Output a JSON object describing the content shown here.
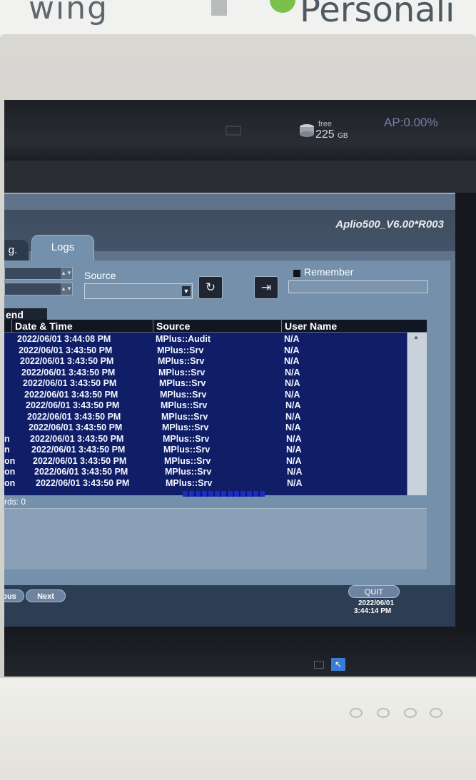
{
  "wall": {
    "left_text": "wing",
    "right_text": "Personali"
  },
  "topbar": {
    "free_label": "free",
    "free_value": "225",
    "free_unit": "GB",
    "ap": "AP:0.00%"
  },
  "dialog": {
    "version": "Aplio500_V6.00*R003",
    "tabs": [
      {
        "label": "g."
      },
      {
        "label": "Logs"
      }
    ],
    "source_label": "Source",
    "source_value": "",
    "remember_label": "Remember",
    "remember_value": "",
    "table": {
      "group_header": "end",
      "columns": [
        "Date & Time",
        "Source",
        "User Name"
      ],
      "rows": [
        {
          "prefix": "",
          "date": "2022/06/01 3:44:08 PM",
          "source": "MPlus::Audit",
          "user": "N/A"
        },
        {
          "prefix": "",
          "date": "2022/06/01 3:43:50 PM",
          "source": "MPlus::Srv",
          "user": "N/A"
        },
        {
          "prefix": "",
          "date": "2022/06/01 3:43:50 PM",
          "source": "MPlus::Srv",
          "user": "N/A"
        },
        {
          "prefix": "",
          "date": "2022/06/01 3:43:50 PM",
          "source": "MPlus::Srv",
          "user": "N/A"
        },
        {
          "prefix": "",
          "date": "2022/06/01 3:43:50 PM",
          "source": "MPlus::Srv",
          "user": "N/A"
        },
        {
          "prefix": "",
          "date": "2022/06/01 3:43:50 PM",
          "source": "MPlus::Srv",
          "user": "N/A"
        },
        {
          "prefix": "",
          "date": "2022/06/01 3:43:50 PM",
          "source": "MPlus::Srv",
          "user": "N/A"
        },
        {
          "prefix": "",
          "date": "2022/06/01 3:43:50 PM",
          "source": "MPlus::Srv",
          "user": "N/A"
        },
        {
          "prefix": "",
          "date": "2022/06/01 3:43:50 PM",
          "source": "MPlus::Srv",
          "user": "N/A"
        },
        {
          "prefix": "n",
          "date": "2022/06/01 3:43:50 PM",
          "source": "MPlus::Srv",
          "user": "N/A"
        },
        {
          "prefix": "n",
          "date": "2022/06/01 3:43:50 PM",
          "source": "MPlus::Srv",
          "user": "N/A"
        },
        {
          "prefix": "on",
          "date": "2022/06/01 3:43:50 PM",
          "source": "MPlus::Srv",
          "user": "N/A"
        },
        {
          "prefix": "on",
          "date": "2022/06/01 3:43:50 PM",
          "source": "MPlus::Srv",
          "user": "N/A"
        },
        {
          "prefix": "on",
          "date": "2022/06/01 3:43:50 PM",
          "source": "MPlus::Srv",
          "user": "N/A"
        }
      ]
    },
    "records": "rds: 0",
    "previous_label": "ous",
    "next_label": "Next",
    "quit_label": "QUIT",
    "clock_date": "2022/06/01",
    "clock_time": "3:44:14 PM"
  }
}
